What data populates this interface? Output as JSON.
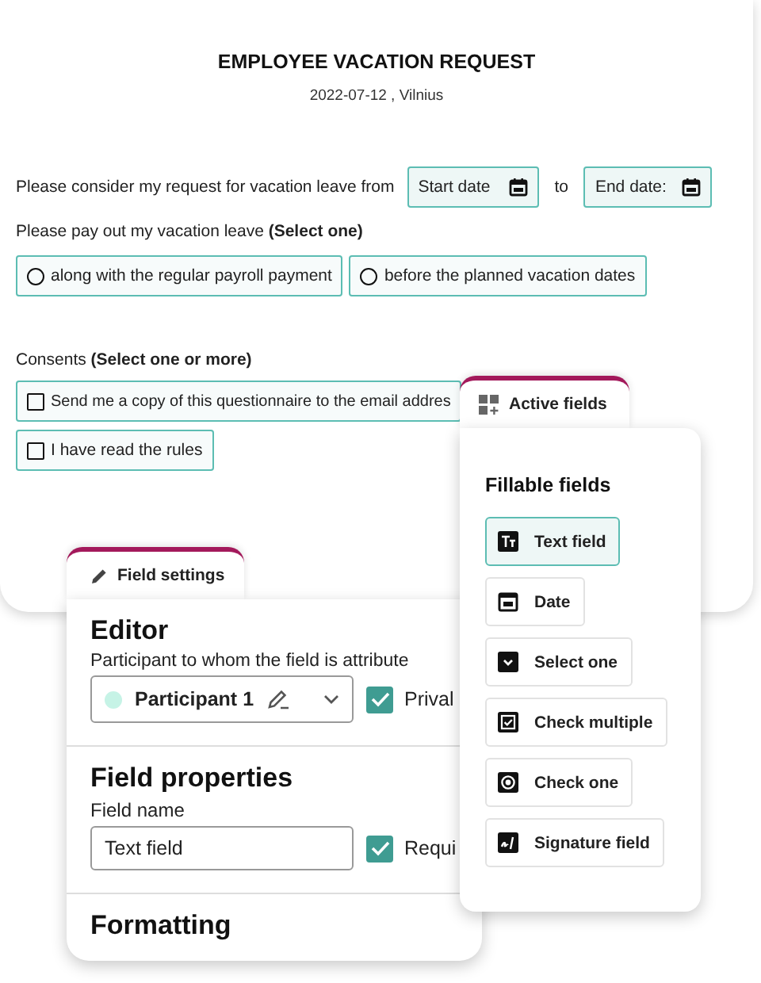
{
  "document": {
    "title": "EMPLOYEE VACATION REQUEST",
    "subtitle": "2022-07-12 , Vilnius",
    "leave_row": {
      "label": "Please consider my request for vacation leave from",
      "start_date": {
        "placeholder": "Start date"
      },
      "separator": "to",
      "end_date": {
        "placeholder": "End date:"
      }
    },
    "payout": {
      "label": "Please pay out my vacation leave **(Select one)**",
      "options": [
        {
          "label": "along with the regular payroll payment",
          "selected": false
        },
        {
          "label": "before the planned vacation dates",
          "selected": false
        }
      ]
    },
    "consents": {
      "label": "Consents **(Select one or more)**",
      "options": [
        {
          "label": "Send me a copy of this questionnaire to the email addres",
          "checked": false
        },
        {
          "label": "I have read the rules",
          "checked": false
        }
      ]
    }
  },
  "field_settings": {
    "tab": "Field settings",
    "editor": {
      "title": "Editor",
      "label": "Participant to whom the field is attribute",
      "participant": {
        "name": "Participant 1",
        "color": "#c6f3e6"
      },
      "checkbox": {
        "label": "Prival",
        "checked": true
      }
    },
    "properties": {
      "title": "Field properties",
      "label": "Field name",
      "value": "Text field",
      "checkbox": {
        "label": "Requi",
        "checked": true
      }
    },
    "formatting": {
      "title": "Formatting"
    }
  },
  "active_fields": {
    "tab": "Active fields",
    "heading": "Fillable fields",
    "items": [
      {
        "label": "Text field",
        "kind": "text",
        "selected": true
      },
      {
        "label": "Date",
        "kind": "date",
        "selected": false
      },
      {
        "label": "Select one",
        "kind": "select",
        "selected": false
      },
      {
        "label": "Check multiple",
        "kind": "multi",
        "selected": false
      },
      {
        "label": "Check one",
        "kind": "radio",
        "selected": false
      },
      {
        "label": "Signature field",
        "kind": "signature",
        "selected": false
      }
    ]
  }
}
